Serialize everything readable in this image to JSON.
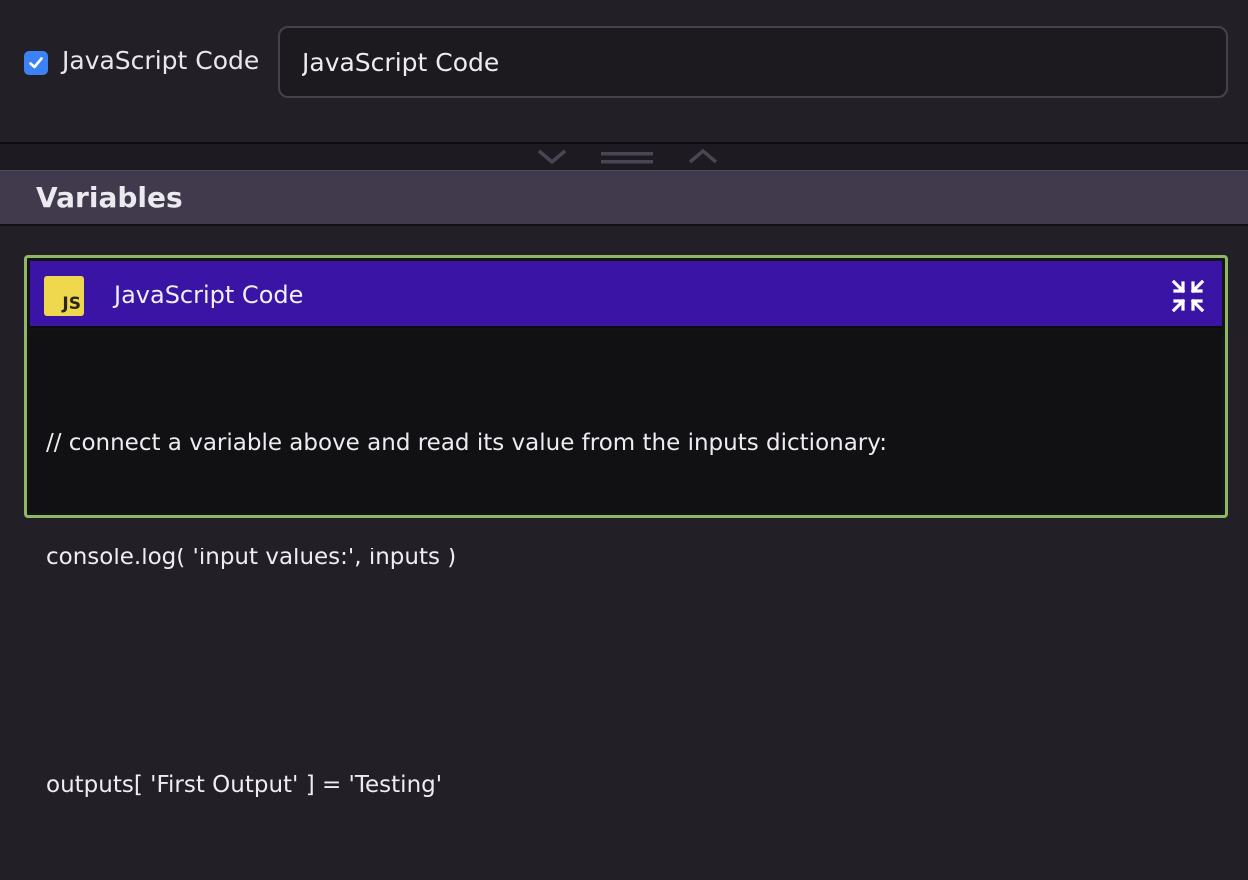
{
  "node": {
    "enabled": true,
    "checkbox_label": "JavaScript Code",
    "name_value": "JavaScript Code"
  },
  "variables_section": {
    "title": "Variables"
  },
  "code_panel": {
    "title": "JavaScript Code",
    "icon_text": "JS",
    "lines": [
      "// connect a variable above and read its value from the inputs dictionary:",
      "console.log( 'input values:', inputs )",
      "",
      "outputs[ 'First Output' ] = 'Testing'"
    ]
  },
  "colors": {
    "accent_purple": "#3914a5",
    "focus_border": "#8db865",
    "checkbox_blue": "#3d82f4",
    "js_yellow": "#f0d84e"
  }
}
